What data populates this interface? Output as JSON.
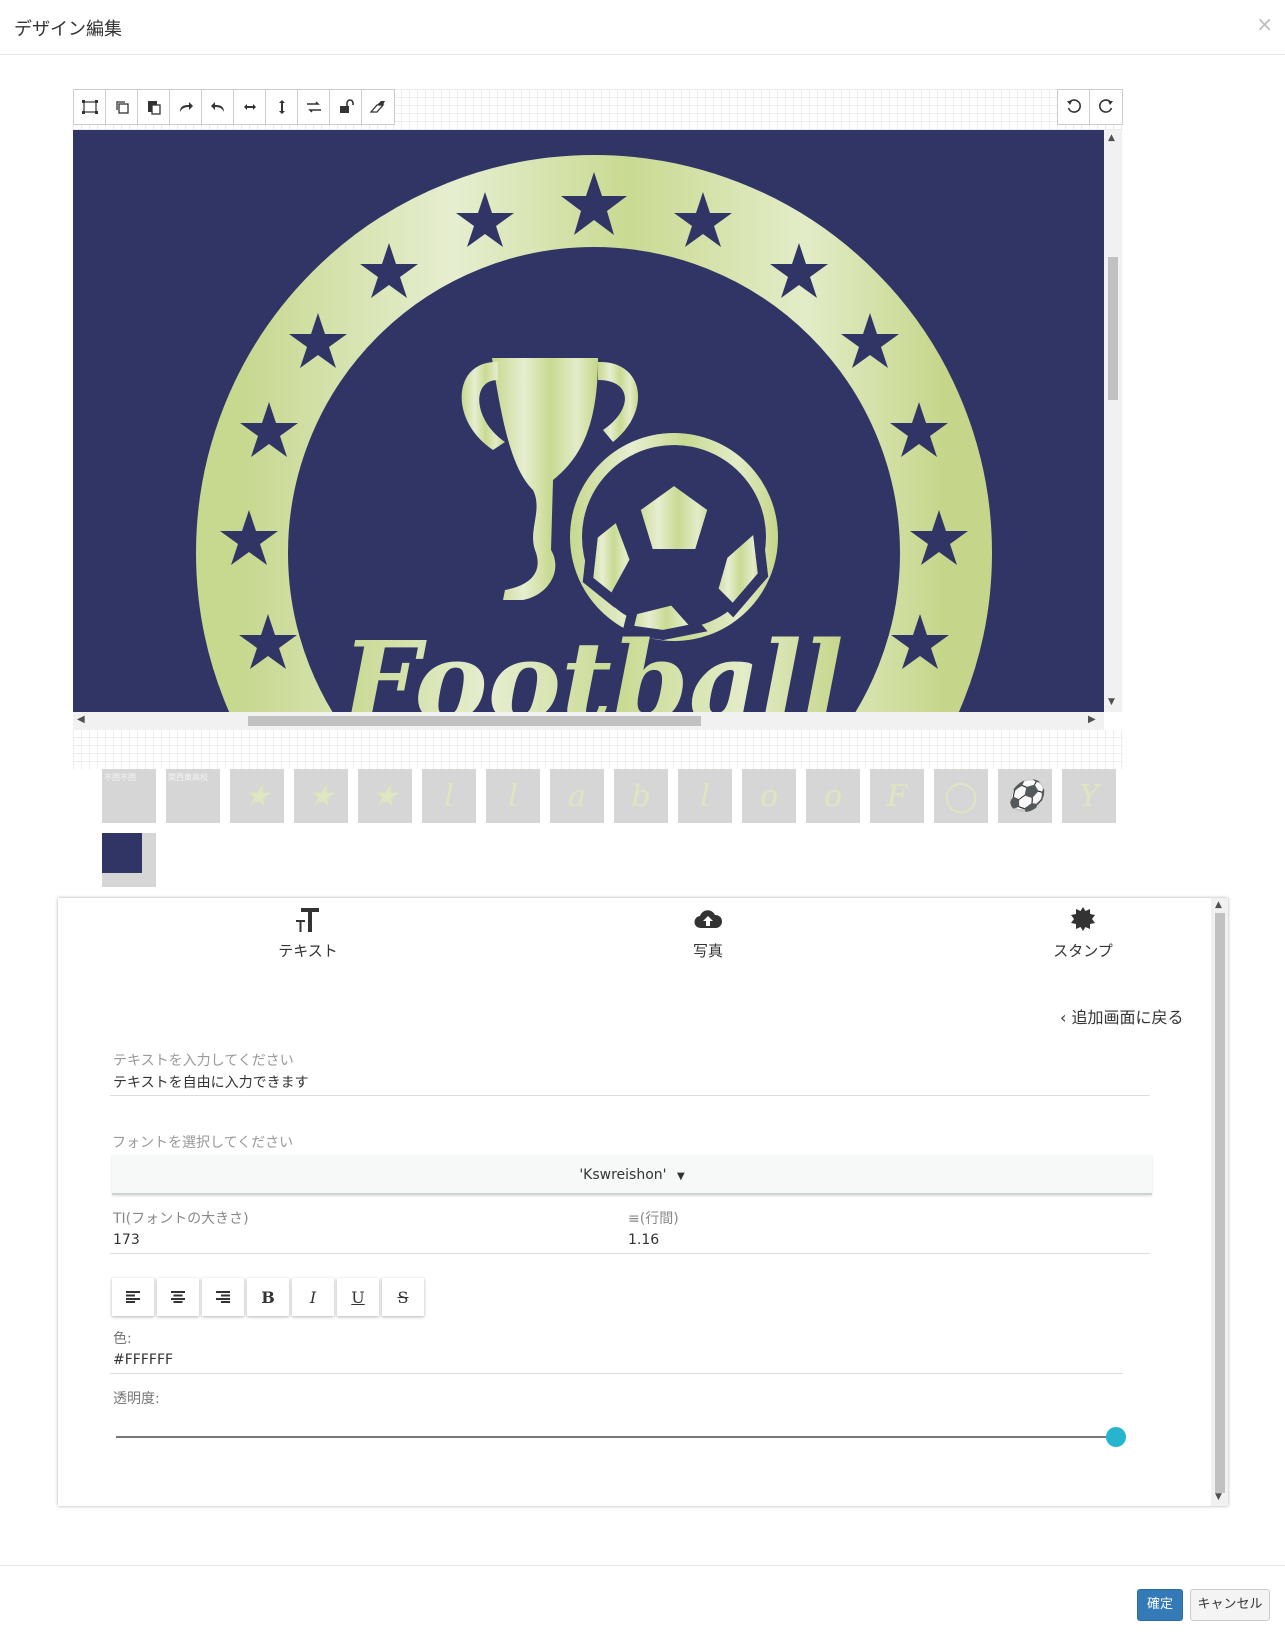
{
  "modal": {
    "title": "デザイン編集",
    "close": "×"
  },
  "toolbar": {
    "left_icons": [
      "crop-select-icon",
      "copy-icon",
      "paste-icon",
      "redo-arrow-icon",
      "undo-arrow-icon",
      "flip-horizontal-icon",
      "flip-vertical-icon",
      "swap-icon",
      "unlock-icon",
      "eraser-icon"
    ],
    "right_icons": [
      "rotate-left-icon",
      "rotate-right-icon"
    ]
  },
  "canvas": {
    "background": "#313565",
    "accent": "#cfdea0",
    "text": "Football"
  },
  "layers": {
    "row1": [
      {
        "label": "不囲不囲",
        "glyph": ""
      },
      {
        "label": "関西東高校",
        "glyph": ""
      },
      {
        "label": "",
        "glyph": "★"
      },
      {
        "label": "",
        "glyph": "★"
      },
      {
        "label": "",
        "glyph": "★"
      },
      {
        "label": "",
        "glyph": "l"
      },
      {
        "label": "",
        "glyph": "l"
      },
      {
        "label": "",
        "glyph": "a"
      },
      {
        "label": "",
        "glyph": "b"
      },
      {
        "label": "",
        "glyph": "l"
      },
      {
        "label": "",
        "glyph": "o"
      },
      {
        "label": "",
        "glyph": "o"
      },
      {
        "label": "",
        "glyph": "F"
      },
      {
        "label": "",
        "glyph": "◯"
      },
      {
        "label": "",
        "glyph": "⚽"
      },
      {
        "label": "",
        "glyph": "Y"
      }
    ],
    "row2_swatch": "#313565"
  },
  "tabs": [
    {
      "icon": "text-size-icon",
      "label": "テキスト"
    },
    {
      "icon": "cloud-upload-icon",
      "label": "写真"
    },
    {
      "icon": "badge-stamp-icon",
      "label": "スタンプ"
    }
  ],
  "panel": {
    "back_link": "‹  追加画面に戻る",
    "text_label": "テキストを入力してください",
    "text_value": "テキストを自由に入力できます",
    "font_label": "フォントを選択してください",
    "font_value": "'Kswreishon'",
    "font_size_label": "TI(フォントの大きさ)",
    "font_size_value": "173",
    "line_height_label": "≡(行間)",
    "line_height_value": "1.16",
    "format_buttons": [
      "align-left-icon",
      "align-center-icon",
      "align-right-icon",
      "B",
      "I",
      "U",
      "S"
    ],
    "color_label": "色:",
    "color_value": "#FFFFFF",
    "opacity_label": "透明度:",
    "opacity": 1.0
  },
  "footer": {
    "ok": "確定",
    "cancel": "キャンセル"
  }
}
